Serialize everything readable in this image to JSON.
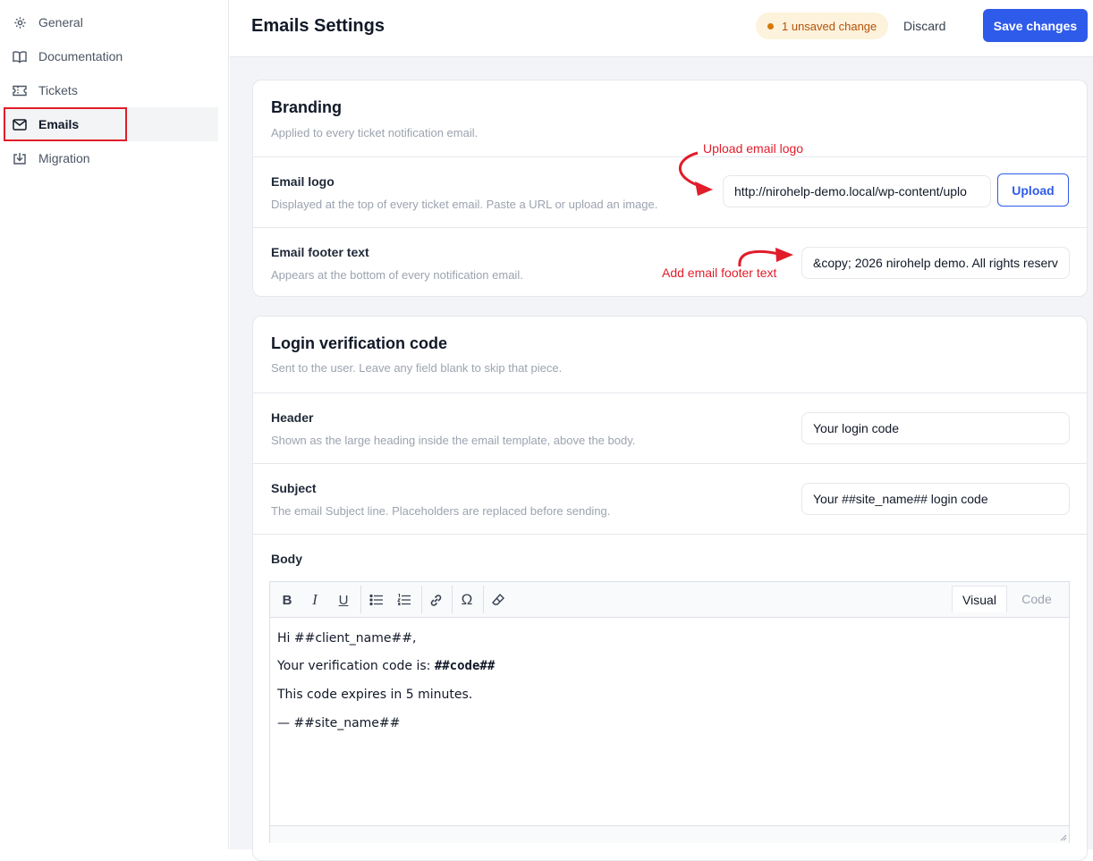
{
  "sidebar": {
    "items": [
      {
        "label": "General",
        "icon": "gear-icon"
      },
      {
        "label": "Documentation",
        "icon": "book-icon"
      },
      {
        "label": "Tickets",
        "icon": "ticket-icon"
      },
      {
        "label": "Emails",
        "icon": "mail-icon",
        "active": true
      },
      {
        "label": "Migration",
        "icon": "download-icon"
      }
    ]
  },
  "header": {
    "title": "Emails Settings",
    "unsaved_badge": "1 unsaved change",
    "discard_label": "Discard",
    "save_label": "Save changes"
  },
  "branding": {
    "title": "Branding",
    "subtitle": "Applied to every ticket notification email.",
    "email_logo": {
      "label": "Email logo",
      "help": "Displayed at the top of every ticket email. Paste a URL or upload an image.",
      "value": "http://nirohelp-demo.local/wp-content/uplo",
      "upload_label": "Upload"
    },
    "footer_text": {
      "label": "Email footer text",
      "help": "Appears at the bottom of every notification email.",
      "value": "&copy; 2026 nirohelp demo. All rights reserv"
    }
  },
  "annotations": {
    "upload_logo": "Upload email logo",
    "add_footer": "Add email footer text"
  },
  "login_code": {
    "title": "Login verification code",
    "subtitle": "Sent to the user. Leave any field blank to skip that piece.",
    "header_field": {
      "label": "Header",
      "help": "Shown as the large heading inside the email template, above the body.",
      "value": "Your login code"
    },
    "subject_field": {
      "label": "Subject",
      "help": "The email Subject line. Placeholders are replaced before sending.",
      "value": "Your ##site_name## login code"
    },
    "body": {
      "label": "Body",
      "tab_visual": "Visual",
      "tab_code": "Code",
      "line1": "Hi ##client_name##,",
      "line2_prefix": "Your verification code is: ",
      "line2_code": "##code##",
      "line3": "This code expires in 5 minutes.",
      "line4": "— ##site_name##"
    }
  },
  "colors": {
    "accent": "#2f5bea",
    "annotation_red": "#e11d2a",
    "badge_bg": "#fdf2dc",
    "badge_text": "#b45309"
  }
}
